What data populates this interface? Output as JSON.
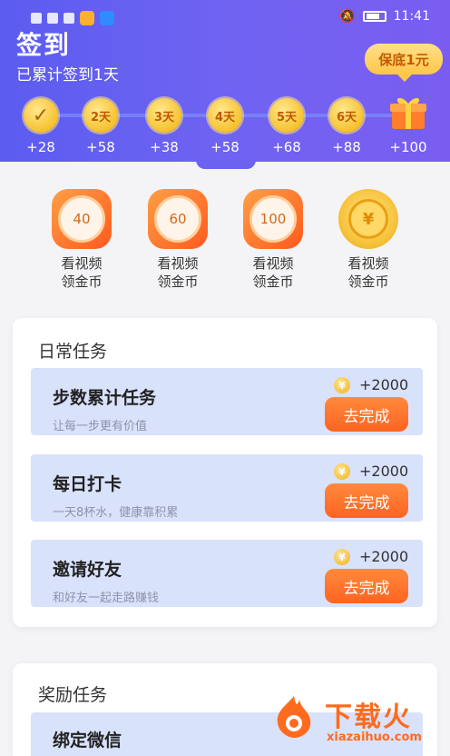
{
  "status_bar": {
    "time": "11:41"
  },
  "header": {
    "title": "签到",
    "subtitle": "已累计签到1天",
    "guarantee_label": "保底1元",
    "check_mark": "✓",
    "days": [
      {
        "label": "✓",
        "reward": "+28",
        "done": true
      },
      {
        "label": "2天",
        "reward": "+58"
      },
      {
        "label": "3天",
        "reward": "+38"
      },
      {
        "label": "4天",
        "reward": "+58"
      },
      {
        "label": "5天",
        "reward": "+68"
      },
      {
        "label": "6天",
        "reward": "+88"
      },
      {
        "label": "gift",
        "reward": "+100"
      }
    ]
  },
  "videos": [
    {
      "value": "40",
      "label_line1": "看视频",
      "label_line2": "领金币"
    },
    {
      "value": "60",
      "label_line1": "看视频",
      "label_line2": "领金币"
    },
    {
      "value": "100",
      "label_line1": "看视频",
      "label_line2": "领金币"
    },
    {
      "value": "¥",
      "label_line1": "看视频",
      "label_line2": "领金币"
    }
  ],
  "daily": {
    "title": "日常任务",
    "tasks": [
      {
        "name": "步数累计任务",
        "desc": "让每一步更有价值",
        "points": "+2000",
        "button": "去完成"
      },
      {
        "name": "每日打卡",
        "desc": "一天8杯水，健康靠积累",
        "points": "+2000",
        "button": "去完成"
      },
      {
        "name": "邀请好友",
        "desc": "和好友一起走路赚钱",
        "points": "+2000",
        "button": "去完成"
      }
    ]
  },
  "reward": {
    "title": "奖励任务",
    "tasks": [
      {
        "name": "绑定微信"
      }
    ]
  },
  "watermark": {
    "text": "下载火",
    "url": "xiazaihuo.com"
  },
  "colors": {
    "header": "#5b5cf0",
    "accent": "#ff6420",
    "coin": "#f6c12d"
  }
}
